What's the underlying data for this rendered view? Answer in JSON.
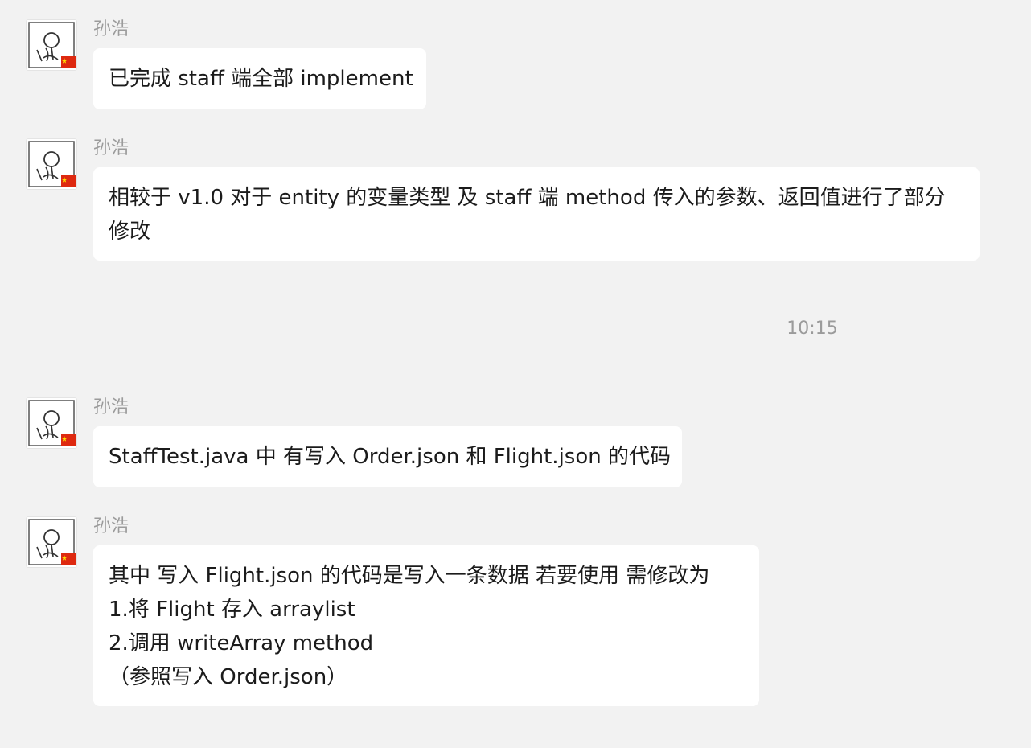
{
  "messages": [
    {
      "sender": "孙浩",
      "lines": [
        "已完成 staff 端全部 implement"
      ]
    },
    {
      "sender": "孙浩",
      "lines": [
        "相较于 v1.0 对于 entity 的变量类型 及 staff 端 method 传入的参数、返回值进行了部分修改"
      ]
    },
    {
      "sender": "孙浩",
      "lines": [
        "StaffTest.java 中 有写入 Order.json 和 Flight.json 的代码"
      ]
    },
    {
      "sender": "孙浩",
      "lines": [
        "其中 写入 Flight.json 的代码是写入一条数据 若要使用 需修改为",
        "1.将 Flight 存入 arraylist",
        "2.调用 writeArray method",
        "（参照写入 Order.json）"
      ]
    }
  ],
  "timestamp": "10:15",
  "avatar": {
    "icon": "stick-figure-avatar-icon",
    "badge": "china-flag-badge-icon",
    "flag_color": "#de2910",
    "star_color": "#ffde00"
  }
}
